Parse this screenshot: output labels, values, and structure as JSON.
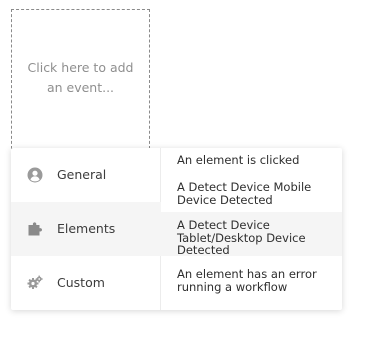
{
  "placeholder": {
    "text": "Click here to add an event..."
  },
  "categories": [
    {
      "label": "General",
      "icon": "user-circle-icon"
    },
    {
      "label": "Elements",
      "icon": "puzzle-piece-icon"
    },
    {
      "label": "Custom",
      "icon": "gears-icon"
    }
  ],
  "events": [
    {
      "label": "An element is clicked"
    },
    {
      "label": "A Detect Device Mobile Device Detected"
    },
    {
      "label": "A Detect Device Tablet/Desktop Device Detected"
    },
    {
      "label": "An element has an error running a workflow"
    }
  ]
}
